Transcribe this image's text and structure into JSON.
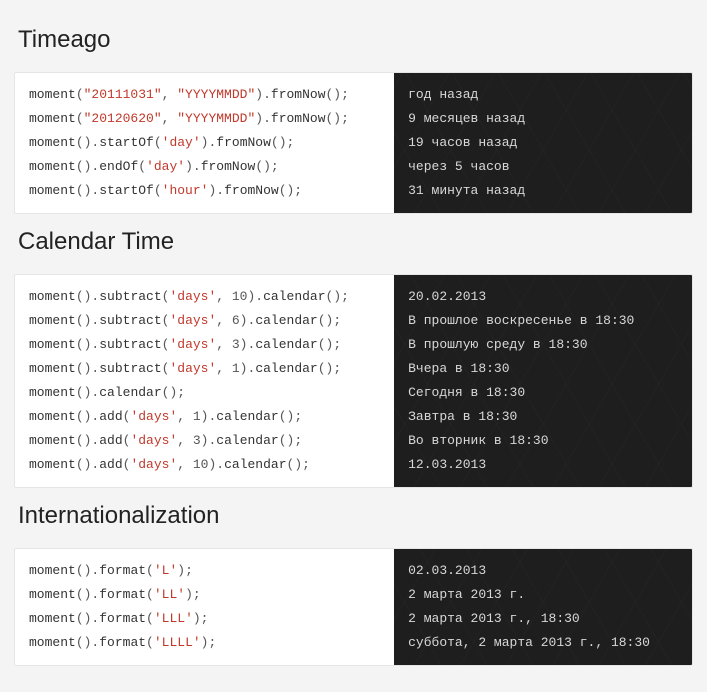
{
  "sections": [
    {
      "title": "Timeago",
      "rows": [
        {
          "tokens": [
            {
              "t": "moment",
              "c": "fn"
            },
            {
              "t": "(",
              "c": "punct"
            },
            {
              "t": "\"20111031\"",
              "c": "str"
            },
            {
              "t": ", ",
              "c": "punct"
            },
            {
              "t": "\"YYYYMMDD\"",
              "c": "str"
            },
            {
              "t": ")",
              "c": "punct"
            },
            {
              "t": ".",
              "c": "dot"
            },
            {
              "t": "fromNow",
              "c": "fn"
            },
            {
              "t": "();",
              "c": "punct"
            }
          ],
          "output": "год назад"
        },
        {
          "tokens": [
            {
              "t": "moment",
              "c": "fn"
            },
            {
              "t": "(",
              "c": "punct"
            },
            {
              "t": "\"20120620\"",
              "c": "str"
            },
            {
              "t": ", ",
              "c": "punct"
            },
            {
              "t": "\"YYYYMMDD\"",
              "c": "str"
            },
            {
              "t": ")",
              "c": "punct"
            },
            {
              "t": ".",
              "c": "dot"
            },
            {
              "t": "fromNow",
              "c": "fn"
            },
            {
              "t": "();",
              "c": "punct"
            }
          ],
          "output": "9 месяцев назад"
        },
        {
          "tokens": [
            {
              "t": "moment",
              "c": "fn"
            },
            {
              "t": "()",
              "c": "punct"
            },
            {
              "t": ".",
              "c": "dot"
            },
            {
              "t": "startOf",
              "c": "fn"
            },
            {
              "t": "(",
              "c": "punct"
            },
            {
              "t": "'day'",
              "c": "str"
            },
            {
              "t": ")",
              "c": "punct"
            },
            {
              "t": ".",
              "c": "dot"
            },
            {
              "t": "fromNow",
              "c": "fn"
            },
            {
              "t": "();",
              "c": "punct"
            }
          ],
          "output": "19 часов назад"
        },
        {
          "tokens": [
            {
              "t": "moment",
              "c": "fn"
            },
            {
              "t": "()",
              "c": "punct"
            },
            {
              "t": ".",
              "c": "dot"
            },
            {
              "t": "endOf",
              "c": "fn"
            },
            {
              "t": "(",
              "c": "punct"
            },
            {
              "t": "'day'",
              "c": "str"
            },
            {
              "t": ")",
              "c": "punct"
            },
            {
              "t": ".",
              "c": "dot"
            },
            {
              "t": "fromNow",
              "c": "fn"
            },
            {
              "t": "();",
              "c": "punct"
            }
          ],
          "output": "через 5 часов"
        },
        {
          "tokens": [
            {
              "t": "moment",
              "c": "fn"
            },
            {
              "t": "()",
              "c": "punct"
            },
            {
              "t": ".",
              "c": "dot"
            },
            {
              "t": "startOf",
              "c": "fn"
            },
            {
              "t": "(",
              "c": "punct"
            },
            {
              "t": "'hour'",
              "c": "str"
            },
            {
              "t": ")",
              "c": "punct"
            },
            {
              "t": ".",
              "c": "dot"
            },
            {
              "t": "fromNow",
              "c": "fn"
            },
            {
              "t": "();",
              "c": "punct"
            }
          ],
          "output": "31 минута назад"
        }
      ]
    },
    {
      "title": "Calendar Time",
      "rows": [
        {
          "tokens": [
            {
              "t": "moment",
              "c": "fn"
            },
            {
              "t": "()",
              "c": "punct"
            },
            {
              "t": ".",
              "c": "dot"
            },
            {
              "t": "subtract",
              "c": "fn"
            },
            {
              "t": "(",
              "c": "punct"
            },
            {
              "t": "'days'",
              "c": "str"
            },
            {
              "t": ", 10)",
              "c": "punct"
            },
            {
              "t": ".",
              "c": "dot"
            },
            {
              "t": "calendar",
              "c": "fn"
            },
            {
              "t": "();",
              "c": "punct"
            }
          ],
          "output": "20.02.2013"
        },
        {
          "tokens": [
            {
              "t": "moment",
              "c": "fn"
            },
            {
              "t": "()",
              "c": "punct"
            },
            {
              "t": ".",
              "c": "dot"
            },
            {
              "t": "subtract",
              "c": "fn"
            },
            {
              "t": "(",
              "c": "punct"
            },
            {
              "t": "'days'",
              "c": "str"
            },
            {
              "t": ", 6)",
              "c": "punct"
            },
            {
              "t": ".",
              "c": "dot"
            },
            {
              "t": "calendar",
              "c": "fn"
            },
            {
              "t": "();",
              "c": "punct"
            }
          ],
          "output": "В прошлое воскресенье в 18:30"
        },
        {
          "tokens": [
            {
              "t": "moment",
              "c": "fn"
            },
            {
              "t": "()",
              "c": "punct"
            },
            {
              "t": ".",
              "c": "dot"
            },
            {
              "t": "subtract",
              "c": "fn"
            },
            {
              "t": "(",
              "c": "punct"
            },
            {
              "t": "'days'",
              "c": "str"
            },
            {
              "t": ", 3)",
              "c": "punct"
            },
            {
              "t": ".",
              "c": "dot"
            },
            {
              "t": "calendar",
              "c": "fn"
            },
            {
              "t": "();",
              "c": "punct"
            }
          ],
          "output": "В прошлую среду в 18:30"
        },
        {
          "tokens": [
            {
              "t": "moment",
              "c": "fn"
            },
            {
              "t": "()",
              "c": "punct"
            },
            {
              "t": ".",
              "c": "dot"
            },
            {
              "t": "subtract",
              "c": "fn"
            },
            {
              "t": "(",
              "c": "punct"
            },
            {
              "t": "'days'",
              "c": "str"
            },
            {
              "t": ", 1)",
              "c": "punct"
            },
            {
              "t": ".",
              "c": "dot"
            },
            {
              "t": "calendar",
              "c": "fn"
            },
            {
              "t": "();",
              "c": "punct"
            }
          ],
          "output": "Вчера в 18:30"
        },
        {
          "tokens": [
            {
              "t": "moment",
              "c": "fn"
            },
            {
              "t": "()",
              "c": "punct"
            },
            {
              "t": ".",
              "c": "dot"
            },
            {
              "t": "calendar",
              "c": "fn"
            },
            {
              "t": "();",
              "c": "punct"
            }
          ],
          "output": "Сегодня в 18:30"
        },
        {
          "tokens": [
            {
              "t": "moment",
              "c": "fn"
            },
            {
              "t": "()",
              "c": "punct"
            },
            {
              "t": ".",
              "c": "dot"
            },
            {
              "t": "add",
              "c": "fn"
            },
            {
              "t": "(",
              "c": "punct"
            },
            {
              "t": "'days'",
              "c": "str"
            },
            {
              "t": ", 1)",
              "c": "punct"
            },
            {
              "t": ".",
              "c": "dot"
            },
            {
              "t": "calendar",
              "c": "fn"
            },
            {
              "t": "();",
              "c": "punct"
            }
          ],
          "output": "Завтра в 18:30"
        },
        {
          "tokens": [
            {
              "t": "moment",
              "c": "fn"
            },
            {
              "t": "()",
              "c": "punct"
            },
            {
              "t": ".",
              "c": "dot"
            },
            {
              "t": "add",
              "c": "fn"
            },
            {
              "t": "(",
              "c": "punct"
            },
            {
              "t": "'days'",
              "c": "str"
            },
            {
              "t": ", 3)",
              "c": "punct"
            },
            {
              "t": ".",
              "c": "dot"
            },
            {
              "t": "calendar",
              "c": "fn"
            },
            {
              "t": "();",
              "c": "punct"
            }
          ],
          "output": "Во вторник в 18:30"
        },
        {
          "tokens": [
            {
              "t": "moment",
              "c": "fn"
            },
            {
              "t": "()",
              "c": "punct"
            },
            {
              "t": ".",
              "c": "dot"
            },
            {
              "t": "add",
              "c": "fn"
            },
            {
              "t": "(",
              "c": "punct"
            },
            {
              "t": "'days'",
              "c": "str"
            },
            {
              "t": ", 10)",
              "c": "punct"
            },
            {
              "t": ".",
              "c": "dot"
            },
            {
              "t": "calendar",
              "c": "fn"
            },
            {
              "t": "();",
              "c": "punct"
            }
          ],
          "output": "12.03.2013"
        }
      ]
    },
    {
      "title": "Internationalization",
      "rows": [
        {
          "tokens": [
            {
              "t": "moment",
              "c": "fn"
            },
            {
              "t": "()",
              "c": "punct"
            },
            {
              "t": ".",
              "c": "dot"
            },
            {
              "t": "format",
              "c": "fn"
            },
            {
              "t": "(",
              "c": "punct"
            },
            {
              "t": "'L'",
              "c": "str"
            },
            {
              "t": ");",
              "c": "punct"
            }
          ],
          "output": "02.03.2013"
        },
        {
          "tokens": [
            {
              "t": "moment",
              "c": "fn"
            },
            {
              "t": "()",
              "c": "punct"
            },
            {
              "t": ".",
              "c": "dot"
            },
            {
              "t": "format",
              "c": "fn"
            },
            {
              "t": "(",
              "c": "punct"
            },
            {
              "t": "'LL'",
              "c": "str"
            },
            {
              "t": ");",
              "c": "punct"
            }
          ],
          "output": "2 марта 2013 г."
        },
        {
          "tokens": [
            {
              "t": "moment",
              "c": "fn"
            },
            {
              "t": "()",
              "c": "punct"
            },
            {
              "t": ".",
              "c": "dot"
            },
            {
              "t": "format",
              "c": "fn"
            },
            {
              "t": "(",
              "c": "punct"
            },
            {
              "t": "'LLL'",
              "c": "str"
            },
            {
              "t": ");",
              "c": "punct"
            }
          ],
          "output": "2 марта 2013 г., 18:30"
        },
        {
          "tokens": [
            {
              "t": "moment",
              "c": "fn"
            },
            {
              "t": "()",
              "c": "punct"
            },
            {
              "t": ".",
              "c": "dot"
            },
            {
              "t": "format",
              "c": "fn"
            },
            {
              "t": "(",
              "c": "punct"
            },
            {
              "t": "'LLLL'",
              "c": "str"
            },
            {
              "t": ");",
              "c": "punct"
            }
          ],
          "output": "суббота, 2 марта 2013 г., 18:30"
        }
      ]
    }
  ]
}
